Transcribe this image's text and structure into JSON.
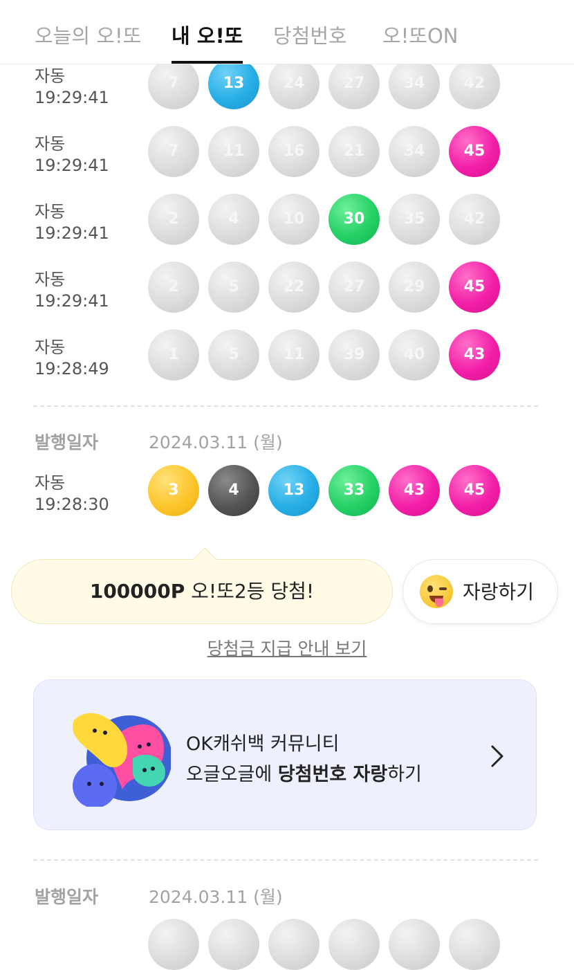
{
  "tabs": [
    {
      "label": "오늘의 오!또"
    },
    {
      "label": "내 오!또"
    },
    {
      "label": "당첨번호"
    },
    {
      "label": "오!또ON"
    }
  ],
  "tickets_group1": [
    {
      "mode": "자동",
      "time": "19:29:41",
      "balls": [
        {
          "n": "7",
          "c": "gray"
        },
        {
          "n": "13",
          "c": "blue"
        },
        {
          "n": "24",
          "c": "gray"
        },
        {
          "n": "27",
          "c": "gray"
        },
        {
          "n": "34",
          "c": "gray"
        },
        {
          "n": "42",
          "c": "gray"
        }
      ]
    },
    {
      "mode": "자동",
      "time": "19:29:41",
      "balls": [
        {
          "n": "7",
          "c": "gray"
        },
        {
          "n": "11",
          "c": "gray"
        },
        {
          "n": "16",
          "c": "gray"
        },
        {
          "n": "21",
          "c": "gray"
        },
        {
          "n": "34",
          "c": "gray"
        },
        {
          "n": "45",
          "c": "pink"
        }
      ]
    },
    {
      "mode": "자동",
      "time": "19:29:41",
      "balls": [
        {
          "n": "2",
          "c": "gray"
        },
        {
          "n": "4",
          "c": "gray"
        },
        {
          "n": "10",
          "c": "gray"
        },
        {
          "n": "30",
          "c": "green"
        },
        {
          "n": "35",
          "c": "gray"
        },
        {
          "n": "42",
          "c": "gray"
        }
      ]
    },
    {
      "mode": "자동",
      "time": "19:29:41",
      "balls": [
        {
          "n": "2",
          "c": "gray"
        },
        {
          "n": "5",
          "c": "gray"
        },
        {
          "n": "22",
          "c": "gray"
        },
        {
          "n": "27",
          "c": "gray"
        },
        {
          "n": "29",
          "c": "gray"
        },
        {
          "n": "45",
          "c": "pink"
        }
      ]
    },
    {
      "mode": "자동",
      "time": "19:28:49",
      "balls": [
        {
          "n": "1",
          "c": "gray"
        },
        {
          "n": "5",
          "c": "gray"
        },
        {
          "n": "11",
          "c": "gray"
        },
        {
          "n": "39",
          "c": "gray"
        },
        {
          "n": "40",
          "c": "gray"
        },
        {
          "n": "43",
          "c": "pink"
        }
      ]
    }
  ],
  "issue1": {
    "label": "발행일자",
    "date": "2024.03.11 (월)"
  },
  "ticket_win": {
    "mode": "자동",
    "time": "19:28:30",
    "balls": [
      {
        "n": "3",
        "c": "yellow"
      },
      {
        "n": "4",
        "c": "dark"
      },
      {
        "n": "13",
        "c": "blue"
      },
      {
        "n": "33",
        "c": "green"
      },
      {
        "n": "43",
        "c": "pink"
      },
      {
        "n": "45",
        "c": "pink"
      }
    ]
  },
  "win": {
    "points": "100000P",
    "text": " 오!또2등 당첨!"
  },
  "brag": {
    "label": "자랑하기",
    "icon": "winking-tongue-emoji-icon"
  },
  "guide_link": "당첨금 지급 안내 보기",
  "community": {
    "line1": "OK캐쉬백 커뮤니티",
    "line2_pre": "오글오글에 ",
    "line2_bold": "당첨번호 자랑",
    "line2_post": "하기",
    "icon": "chevron-right-icon"
  },
  "issue2": {
    "label": "발행일자",
    "date": "2024.03.11 (월)"
  },
  "colors": {
    "blue": "#27aee6",
    "pink": "#f21fa8",
    "green": "#25d066",
    "yellow": "#fcc52b",
    "dark": "#555555",
    "gray": "#d6d6d6"
  }
}
